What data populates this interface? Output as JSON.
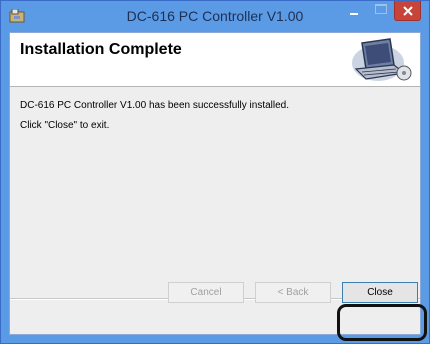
{
  "window": {
    "title": "DC-616 PC Controller V1.00",
    "icon": "installer-icon"
  },
  "titlebar_buttons": {
    "minimize": "minimize-icon",
    "maximize": "maximize-icon",
    "close": "close-icon"
  },
  "header": {
    "title": "Installation Complete",
    "graphic": "computer-setup-icon"
  },
  "body": {
    "line1": "DC-616 PC Controller V1.00 has been successfully installed.",
    "line2": "Click \"Close\" to exit."
  },
  "buttons": {
    "cancel": "Cancel",
    "back": "< Back",
    "close": "Close"
  },
  "colors": {
    "titlebar": "#5b9be6",
    "close_button": "#c7443a",
    "highlight_ring": "#111111"
  }
}
